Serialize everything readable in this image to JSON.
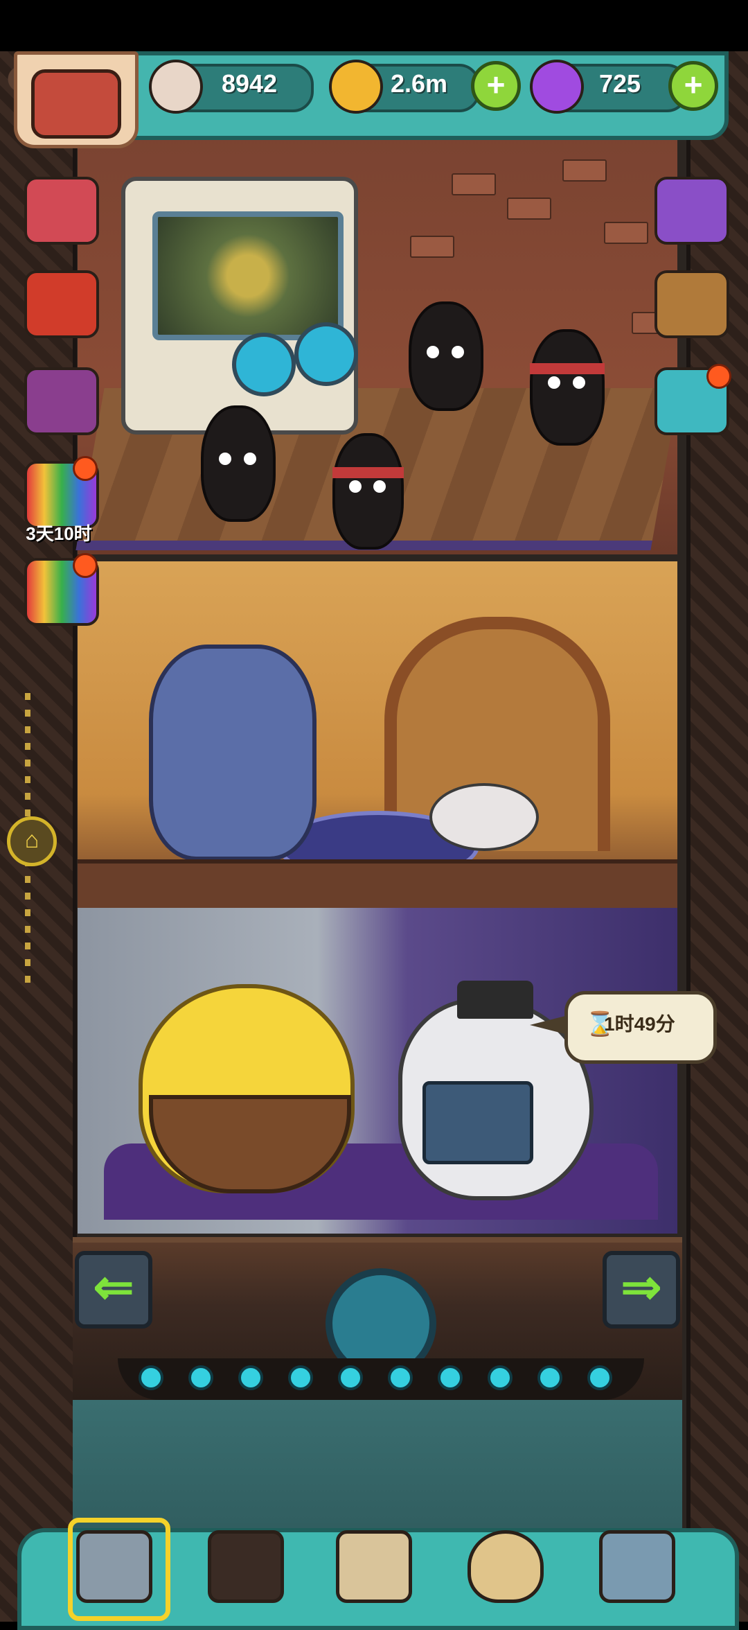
{
  "resources": {
    "eyes": {
      "value": "8942",
      "icon": "eyeball-icon"
    },
    "coins": {
      "value": "2.6m",
      "icon": "gold-coin-icon"
    },
    "potions": {
      "value": "725",
      "icon": "purple-potion-icon"
    }
  },
  "side_menu_left": {
    "items": [
      {
        "icon": "gift-box-icon"
      },
      {
        "icon": "fruit-basket-icon"
      },
      {
        "icon": "cards-icon"
      },
      {
        "icon": "rainbow-gift-icon",
        "timer": "3天10时"
      },
      {
        "icon": "rainbow-gift-icon-2"
      }
    ]
  },
  "side_menu_right": {
    "items": [
      {
        "icon": "video-shop-icon"
      },
      {
        "icon": "backpack-icon"
      },
      {
        "icon": "eggs-icon"
      }
    ]
  },
  "speech_bubble": {
    "text": "1时49分",
    "icon": "hourglass-icon"
  },
  "bottom_nav": {
    "items": [
      {
        "icon": "tower-icon",
        "active": true
      },
      {
        "icon": "monster-icon"
      },
      {
        "icon": "book-icon"
      },
      {
        "icon": "money-bag-icon"
      },
      {
        "icon": "grid-menu-icon"
      }
    ]
  },
  "colors": {
    "resource_bar": "#44b5ae",
    "plus_button": "#8fd63b",
    "active_nav_ring": "#f5d22a",
    "badge": "#ff5a1f"
  }
}
